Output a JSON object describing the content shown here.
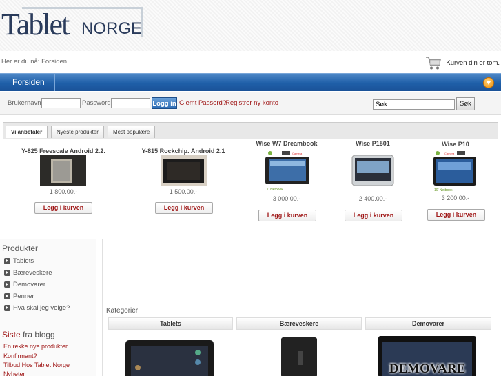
{
  "logo": {
    "tablet": "Tablet",
    "norge": "NORGE"
  },
  "breadcrumb": "Her er du nå: Forsiden",
  "cart": {
    "text": "Kurven din er tom."
  },
  "nav": {
    "home": "Forsiden"
  },
  "login": {
    "username_label": "Brukernavn",
    "password_label": "Password",
    "login_button": "Logg in",
    "forgot_link": "Glemt Passord?",
    "register_link": "Registrer ny konto"
  },
  "search": {
    "value": "Søk",
    "button": "Søk"
  },
  "tabs": [
    "Vi anbefaler",
    "Nyeste produkter",
    "Mest populære"
  ],
  "products": [
    {
      "name": "Y-825 Freescale Android 2.2.",
      "price": "1 800.00.-",
      "button": "Legg i kurven"
    },
    {
      "name": "Y-815 Rockchip. Android 2.1",
      "price": "1 500.00.-",
      "button": "Legg i kurven"
    },
    {
      "name": "Wise W7 Dreambook",
      "price": "3 000.00.-",
      "button": "Legg i kurven"
    },
    {
      "name": "Wise P1501",
      "price": "2 400.00.-",
      "button": "Legg i kurven"
    },
    {
      "name": "Wise P10",
      "price": "3 200.00.-",
      "button": "Legg i kurven"
    }
  ],
  "sidebar": {
    "title": "Produkter",
    "items": [
      "Tablets",
      "Bæreveskere",
      "Demovarer",
      "Penner",
      "Hva skal jeg velge?"
    ],
    "blog_title_a": "Siste",
    "blog_title_b": " fra blogg",
    "blog_items": [
      "En rekke nye produkter.",
      "Konfirmant?",
      "Tilbud Hos Tablet Norge",
      "Nyheter"
    ]
  },
  "categories": {
    "title": "Kategorier",
    "items": [
      "Tablets",
      "Bæreveskere",
      "Demovarer"
    ],
    "demo_overlay": "DEMOVARE"
  },
  "colors": {
    "nav_blue": "#1f5fa8",
    "link_red": "#a01818",
    "accent_orange": "#f08c00"
  }
}
